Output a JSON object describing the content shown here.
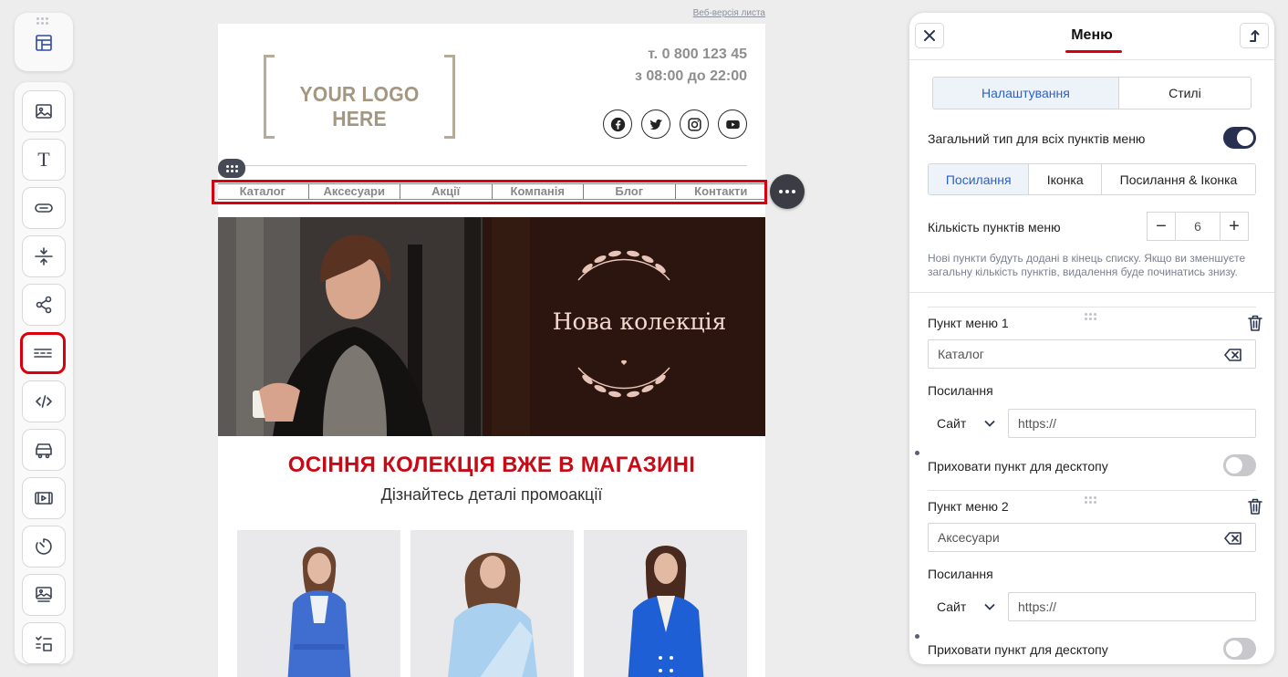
{
  "email": {
    "web_version_link": "Веб-версія листа",
    "logo_text": "YOUR LOGO HERE",
    "phone": "т. 0 800 123 45",
    "hours": "з 08:00 до 22:00",
    "social": [
      "facebook-icon",
      "twitter-icon",
      "instagram-icon",
      "youtube-icon"
    ],
    "menu_items": [
      "Каталог",
      "Аксесуари",
      "Акції",
      "Компанія",
      "Блог",
      "Контакти"
    ],
    "banner_title": "Нова колекція",
    "promo_title": "ОСІННЯ КОЛЕКЦІЯ ВЖЕ В МАГАЗИНІ",
    "promo_subtitle": "Дізнайтесь деталі промоакції"
  },
  "toolbar": {
    "tools": [
      "layout-icon",
      "image-icon",
      "text-icon",
      "button-icon",
      "spacer-icon",
      "share-icon",
      "menu-icon",
      "code-icon",
      "product-icon",
      "video-icon",
      "timer-icon",
      "banner-icon",
      "checklist-icon"
    ],
    "active_tool": "menu-icon"
  },
  "panel": {
    "title": "Меню",
    "tabs": {
      "settings": "Налаштування",
      "styles": "Стилі",
      "active": "settings"
    },
    "common_type_label": "Загальний тип для всіх пунктів меню",
    "common_type_on": true,
    "type_options": {
      "link": "Посилання",
      "icon": "Іконка",
      "link_icon": "Посилання & Іконка",
      "active": "link"
    },
    "count_label": "Кількість пунктів меню",
    "count_minus": "−",
    "count_plus": "+",
    "count_value": "6",
    "hint": "Нові пункти будуть додані в кінець списку. Якщо ви зменшуєте загальну кількість пунктів, видалення буде починатись знизу.",
    "items": [
      {
        "title": "Пункт меню 1",
        "text": "Каталог",
        "link_label": "Посилання",
        "link_type": "Сайт",
        "url": "https://",
        "hide_label": "Приховати пункт для десктопу",
        "hidden": false
      },
      {
        "title": "Пункт меню 2",
        "text": "Аксесуари",
        "link_label": "Посилання",
        "link_type": "Сайт",
        "url": "https://",
        "hide_label": "Приховати пункт для десктопу",
        "hidden": false
      }
    ]
  },
  "colors": {
    "accent_red": "#d9000d",
    "promo_red": "#c70a16",
    "toggle_on": "#273050",
    "tab_active": "#2a62c9"
  }
}
